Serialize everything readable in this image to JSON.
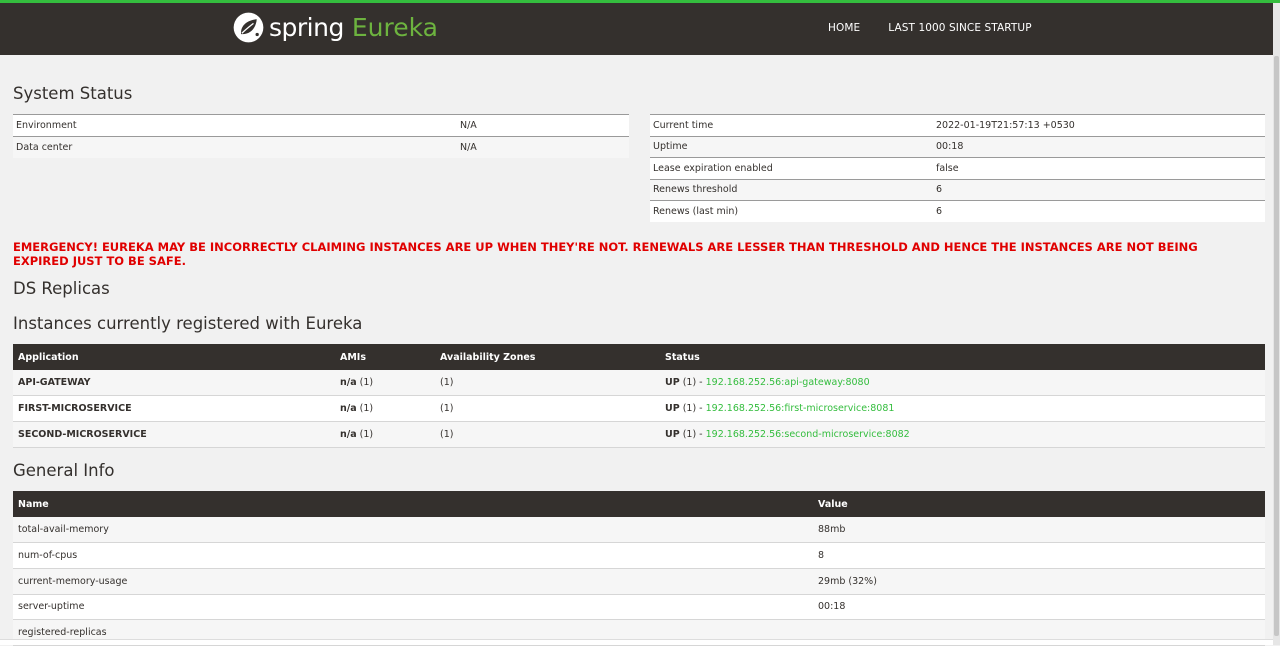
{
  "brand": {
    "spring": "spring",
    "eureka": "Eureka"
  },
  "nav": {
    "home": "HOME",
    "last1000": "LAST 1000 SINCE STARTUP"
  },
  "system_status": {
    "title": "System Status",
    "left": [
      {
        "label": "Environment",
        "value": "N/A"
      },
      {
        "label": "Data center",
        "value": "N/A"
      }
    ],
    "right": [
      {
        "label": "Current time",
        "value": "2022-01-19T21:57:13 +0530"
      },
      {
        "label": "Uptime",
        "value": "00:18"
      },
      {
        "label": "Lease expiration enabled",
        "value": "false"
      },
      {
        "label": "Renews threshold",
        "value": "6"
      },
      {
        "label": "Renews (last min)",
        "value": "6"
      }
    ]
  },
  "emergency": "EMERGENCY! EUREKA MAY BE INCORRECTLY CLAIMING INSTANCES ARE UP WHEN THEY'RE NOT. RENEWALS ARE LESSER THAN THRESHOLD AND HENCE THE INSTANCES ARE NOT BEING EXPIRED JUST TO BE SAFE.",
  "ds_replicas": {
    "title": "DS Replicas"
  },
  "instances": {
    "title": "Instances currently registered with Eureka",
    "columns": [
      "Application",
      "AMIs",
      "Availability Zones",
      "Status"
    ],
    "rows": [
      {
        "app": "API-GATEWAY",
        "ami": "n/a",
        "ami_count": " (1)",
        "zones": "(1)",
        "status": "UP",
        "status_count": " (1) - ",
        "link": "192.168.252.56:api-gateway:8080"
      },
      {
        "app": "FIRST-MICROSERVICE",
        "ami": "n/a",
        "ami_count": " (1)",
        "zones": "(1)",
        "status": "UP",
        "status_count": " (1) - ",
        "link": "192.168.252.56:first-microservice:8081"
      },
      {
        "app": "SECOND-MICROSERVICE",
        "ami": "n/a",
        "ami_count": " (1)",
        "zones": "(1)",
        "status": "UP",
        "status_count": " (1) - ",
        "link": "192.168.252.56:second-microservice:8082"
      }
    ]
  },
  "general_info": {
    "title": "General Info",
    "columns": [
      "Name",
      "Value"
    ],
    "rows": [
      {
        "name": "total-avail-memory",
        "value": "88mb"
      },
      {
        "name": "num-of-cpus",
        "value": "8"
      },
      {
        "name": "current-memory-usage",
        "value": "29mb (32%)"
      },
      {
        "name": "server-uptime",
        "value": "00:18"
      },
      {
        "name": "registered-replicas",
        "value": ""
      }
    ]
  },
  "colors": {
    "nav_bg": "#34302d",
    "accent_green": "#6db33f",
    "link_green": "#34bd3e",
    "emergency_red": "#e00000"
  },
  "icons": {
    "logo": "spring-leaf-icon"
  }
}
